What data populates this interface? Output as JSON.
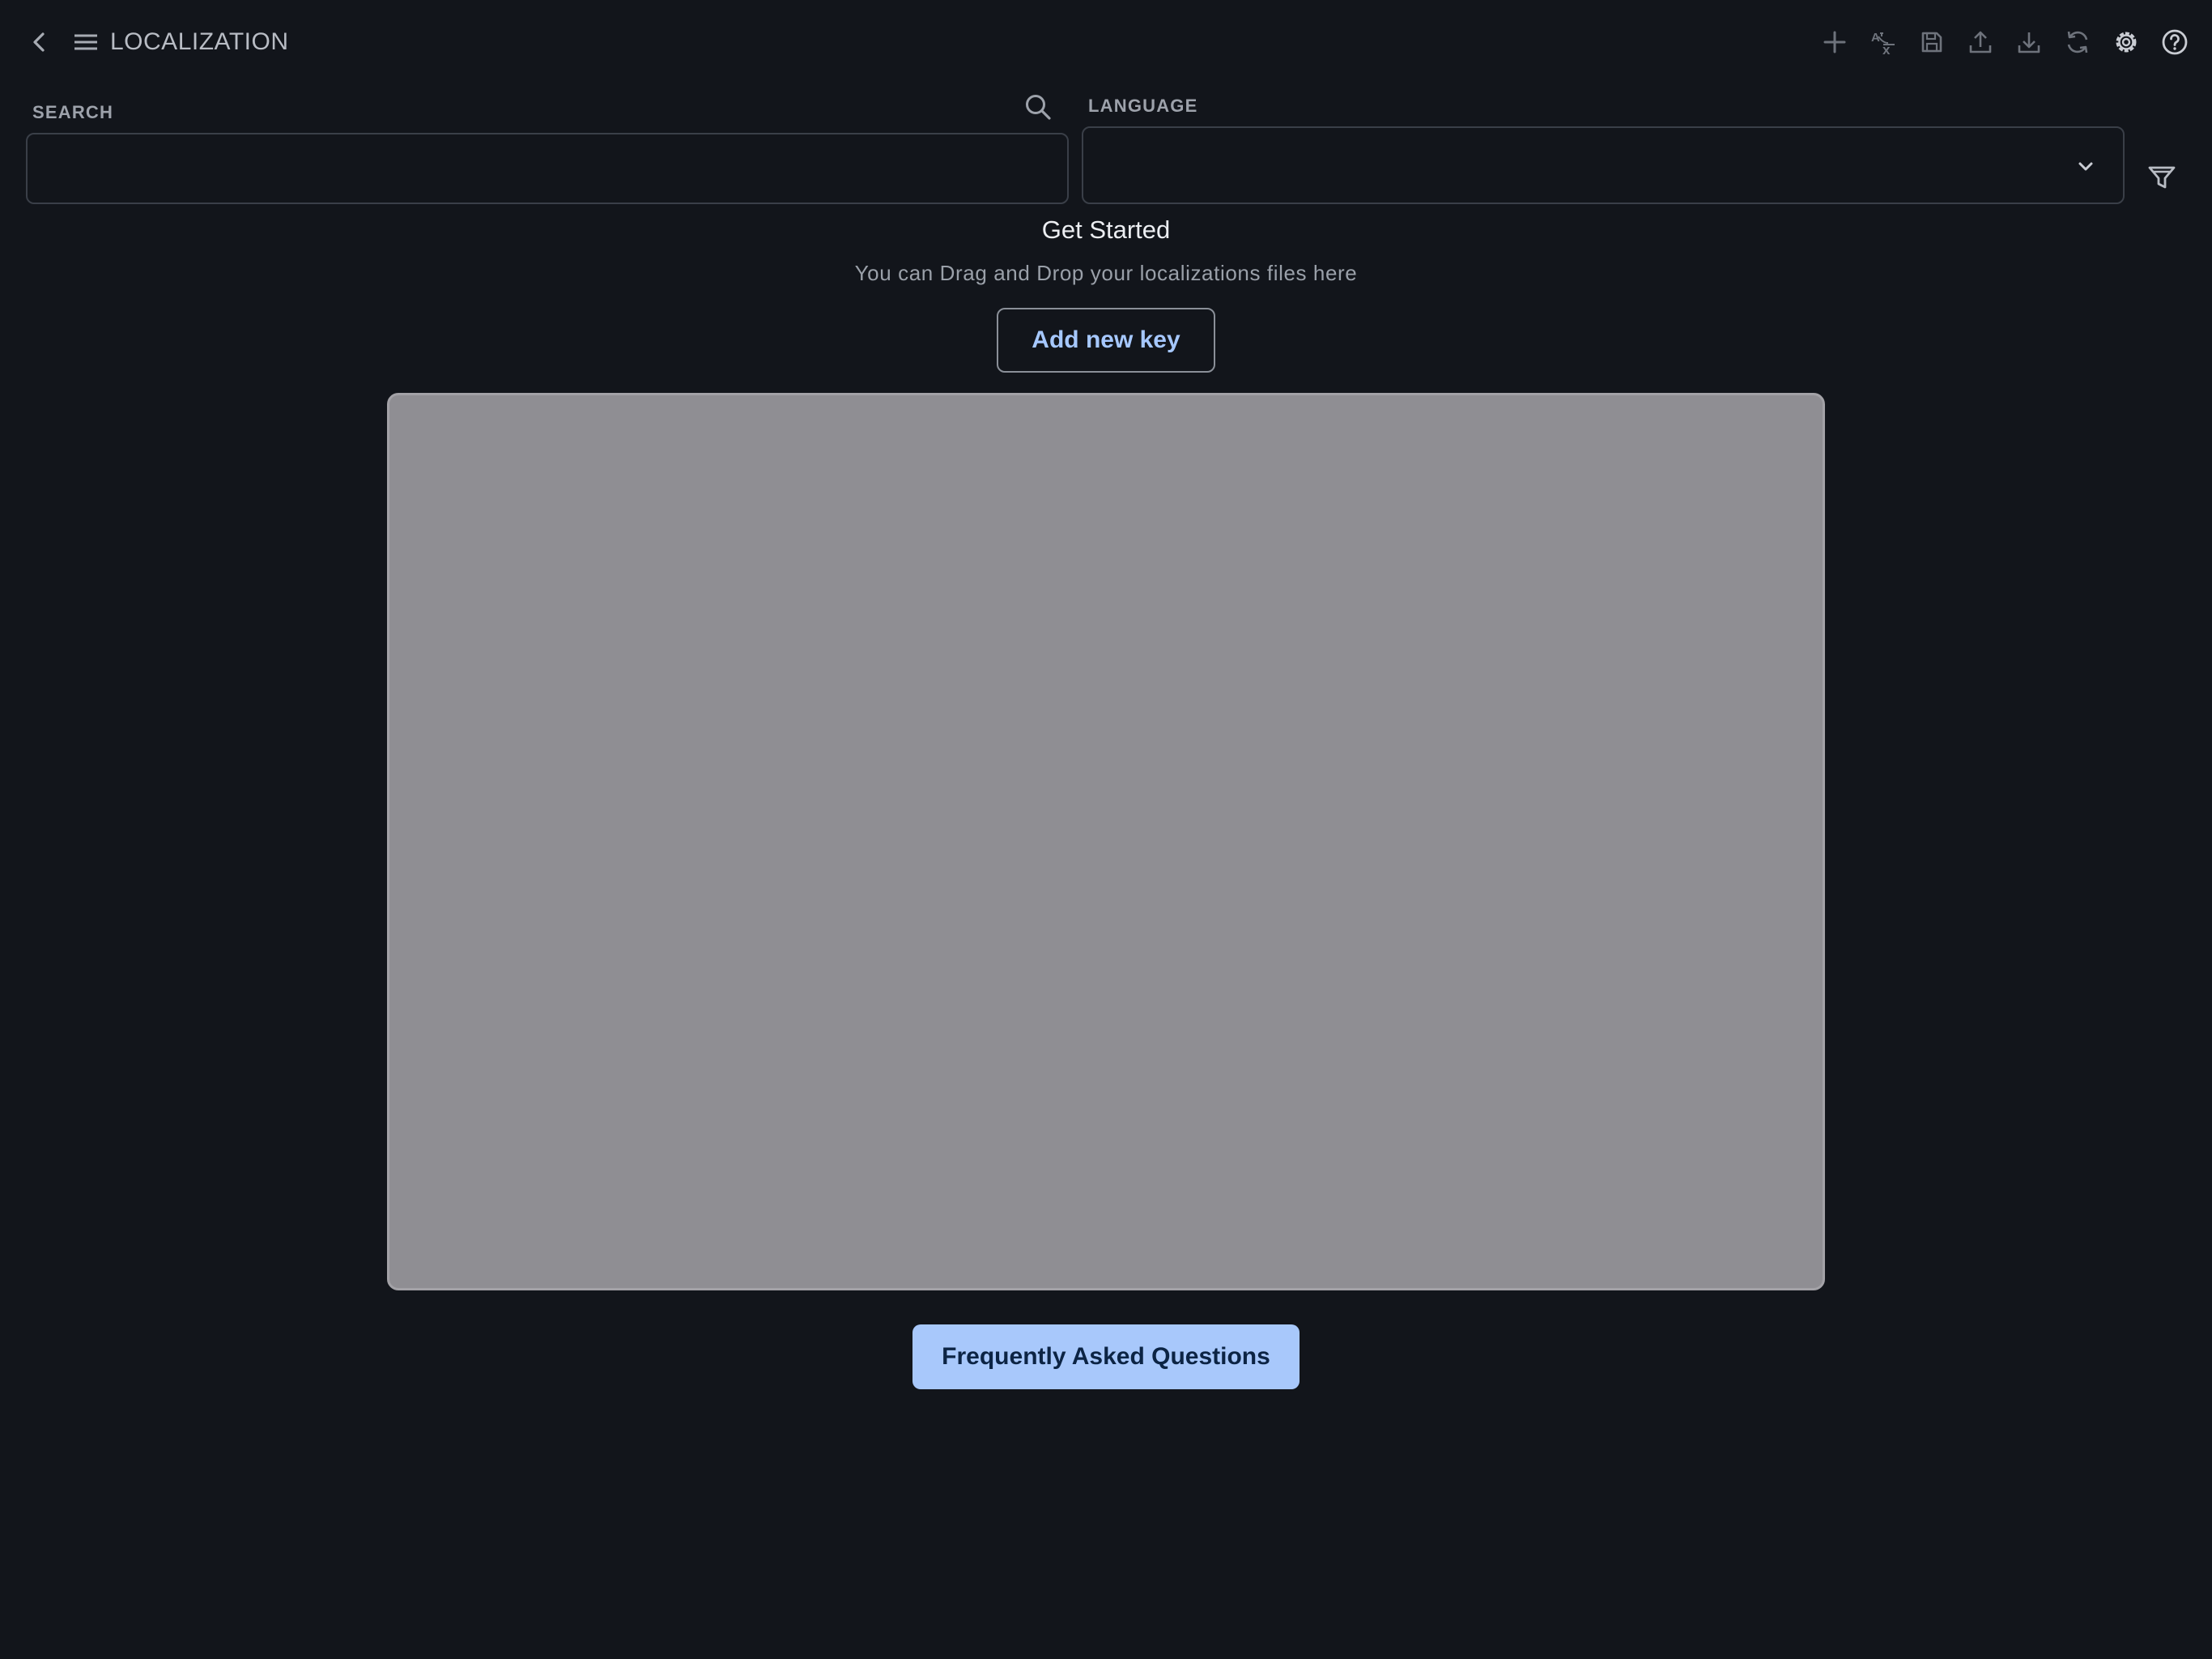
{
  "app": {
    "title": "LOCALIZATION"
  },
  "toolbar": {
    "icons": [
      "add-icon",
      "translate-icon",
      "save-icon",
      "upload-icon",
      "download-icon",
      "sync-icon",
      "settings-icon",
      "help-icon"
    ]
  },
  "search": {
    "label": "SEARCH",
    "value": "",
    "placeholder": ""
  },
  "language": {
    "label": "LANGUAGE",
    "selected": ""
  },
  "empty_state": {
    "heading": "Get Started",
    "message": "You can Drag and Drop your localizations files here",
    "add_key_label": "Add new key"
  },
  "faq": {
    "label": "Frequently Asked Questions"
  },
  "colors": {
    "background": "#12151b",
    "accent": "#a8c8fb",
    "accent_text": "#a6c8ff",
    "icon": "#6e737c",
    "media_placeholder": "#8f8e93"
  }
}
